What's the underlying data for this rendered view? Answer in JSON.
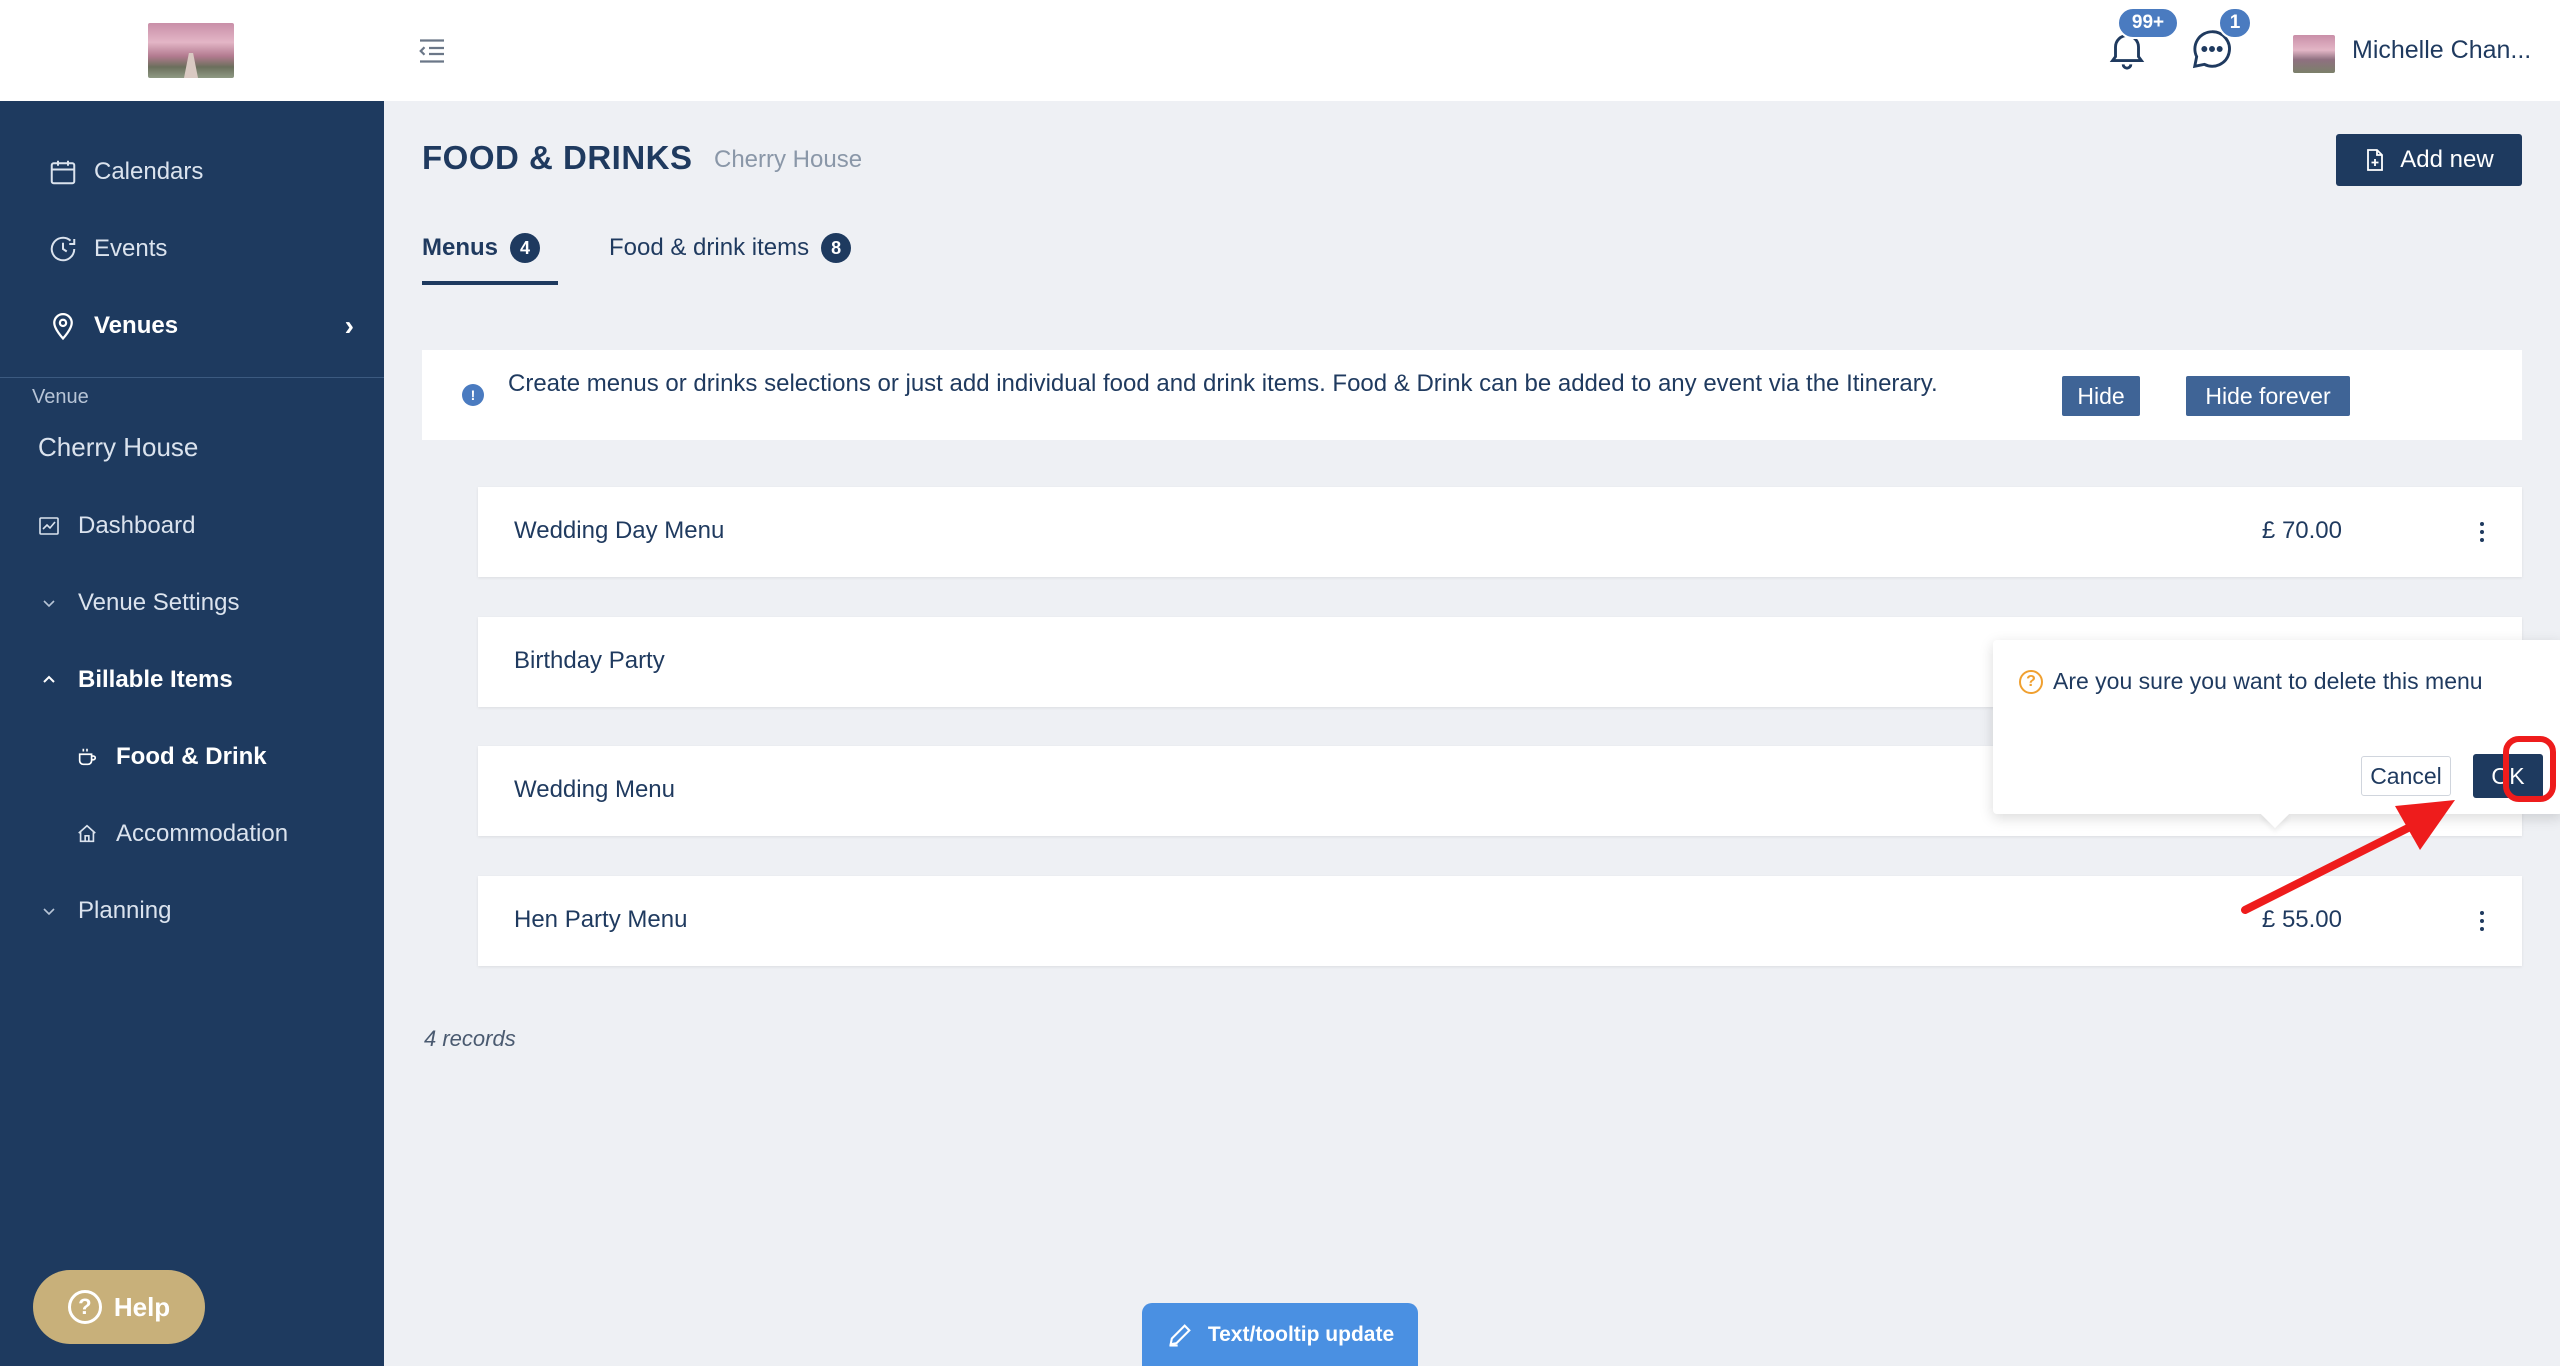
{
  "sidebar": {
    "nav": [
      {
        "label": "Calendars",
        "icon": "calendar-icon"
      },
      {
        "label": "Events",
        "icon": "clock-icon"
      },
      {
        "label": "Venues",
        "icon": "map-pin-icon"
      }
    ],
    "section_label": "Venue",
    "venue_name": "Cherry House",
    "items": [
      {
        "label": "Dashboard",
        "icon": "chart-icon"
      },
      {
        "label": "Venue Settings",
        "icon": "chevron-down-icon"
      },
      {
        "label": "Billable Items",
        "icon": "chevron-up-icon"
      },
      {
        "label": "Food & Drink",
        "icon": "cup-icon"
      },
      {
        "label": "Accommodation",
        "icon": "home-icon"
      },
      {
        "label": "Planning",
        "icon": "chevron-down-icon"
      }
    ],
    "help_label": "Help"
  },
  "topbar": {
    "notifications_badge": "99+",
    "messages_badge": "1",
    "user_name": "Michelle Chan..."
  },
  "page": {
    "title": "FOOD & DRINKS",
    "subtitle": "Cherry House",
    "add_button": "Add new",
    "tabs": [
      {
        "label": "Menus",
        "count": "4"
      },
      {
        "label": "Food & drink items",
        "count": "8"
      }
    ],
    "info_message": "Create menus or drinks selections or just add individual food and drink items. Food & Drink can be added to any event via the Itinerary.",
    "hide_label": "Hide",
    "hide_forever_label": "Hide forever",
    "menus": [
      {
        "name": "Wedding Day Menu",
        "price": "£ 70.00"
      },
      {
        "name": "Birthday Party",
        "price": ""
      },
      {
        "name": "Wedding Menu",
        "price": ""
      },
      {
        "name": "Hen Party Menu",
        "price": "£ 55.00"
      }
    ],
    "records": "4 records"
  },
  "popconfirm": {
    "message": "Are you sure you want to delete this menu",
    "cancel_label": "Cancel",
    "ok_label": "OK"
  },
  "floating_tab": {
    "label": "Text/tooltip update"
  },
  "colors": {
    "sidebar": "#1e3a5f",
    "primary": "#1e3a5f",
    "info_button": "#3f6496",
    "help": "#c8b07a",
    "annotation": "#ee1c1c",
    "floating_tab": "#4a90e2"
  }
}
